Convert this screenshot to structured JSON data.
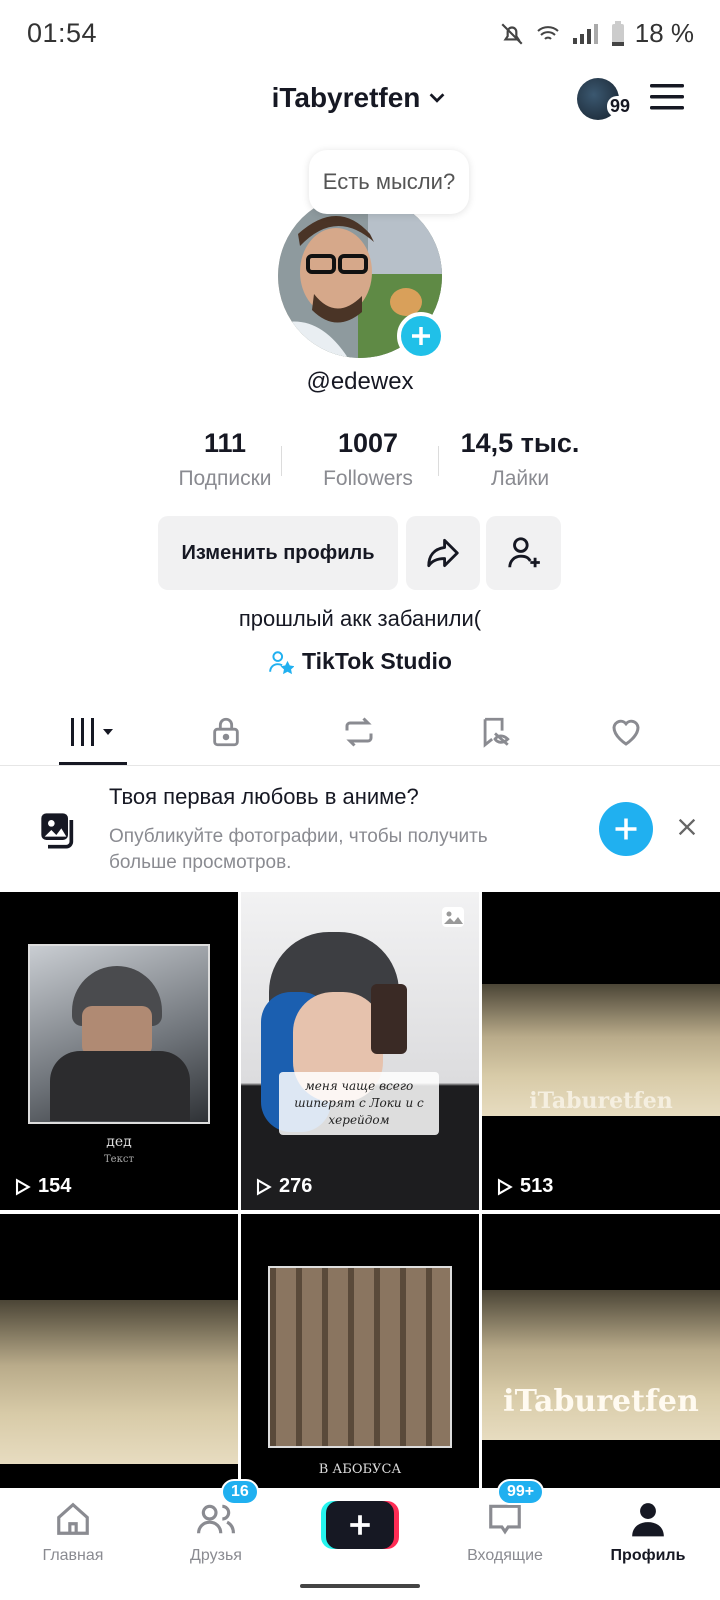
{
  "status_bar": {
    "time": "01:54",
    "battery": "18 %"
  },
  "header": {
    "username": "iTabyretfen",
    "avatar_badge": "99"
  },
  "profile": {
    "thought_prompt": "Есть мысли?",
    "handle": "@edewex",
    "stats": [
      {
        "value": "111",
        "label": "Подписки"
      },
      {
        "value": "1007",
        "label": "Followers"
      },
      {
        "value": "14,5 тыс.",
        "label": "Лайки"
      }
    ],
    "edit_button": "Изменить профиль",
    "bio": "прошлый акк забанили(",
    "studio_link": "TikTok Studio"
  },
  "promo": {
    "title": "Твоя первая любовь в аниме?",
    "subtitle": "Опубликуйте фотографии, чтобы получить больше просмотров."
  },
  "videos": [
    {
      "views": "154",
      "caption": "дед",
      "sub": "Текст"
    },
    {
      "views": "276",
      "caption": "меня чаще всего шиперят с Локи и с херейдом"
    },
    {
      "views": "513",
      "caption": "iTaburetfen"
    },
    {
      "views": "",
      "caption": ""
    },
    {
      "views": "",
      "caption": "В АБОБУСА"
    },
    {
      "views": "",
      "caption": "iTaburetfen"
    }
  ],
  "bottom_nav": {
    "home": "Главная",
    "friends": "Друзья",
    "friends_badge": "16",
    "inbox": "Входящие",
    "inbox_badge": "99+",
    "profile": "Профиль"
  },
  "colors": {
    "accent": "#20b0f0",
    "text": "#161823",
    "muted": "#8a8b91"
  }
}
